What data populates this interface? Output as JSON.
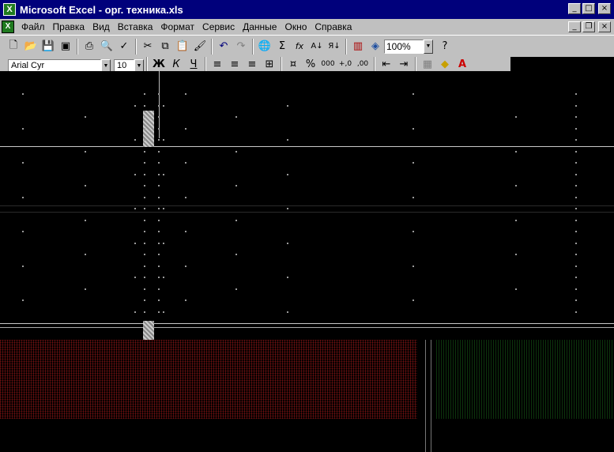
{
  "window": {
    "title": "Microsoft Excel - орг. техника.xls",
    "app_icon": "excel-icon",
    "buttons": {
      "minimize": "_",
      "maximize": "□",
      "close": "×"
    }
  },
  "menu": {
    "items": [
      "Файл",
      "Правка",
      "Вид",
      "Вставка",
      "Формат",
      "Сервис",
      "Данные",
      "Окно",
      "Справка"
    ],
    "doc_buttons": {
      "minimize": "_",
      "restore": "❐",
      "close": "×"
    }
  },
  "toolbar_standard": {
    "icons": [
      "new-icon",
      "open-icon",
      "save-icon",
      "permission-icon",
      "print-icon",
      "print-preview-icon",
      "spelling-icon",
      "cut-icon",
      "copy-icon",
      "paste-icon",
      "format-painter-icon",
      "undo-icon",
      "redo-icon",
      "hyperlink-icon",
      "autosum-icon",
      "function-icon",
      "sort-ascending-icon",
      "sort-descending-icon",
      "chart-wizard-icon",
      "drawing-icon",
      "help-icon"
    ],
    "autosum_glyph": "Σ",
    "function_glyph": "fx",
    "zoom": "100%"
  },
  "toolbar_formatting": {
    "font_name": "Arial Cyr",
    "font_size": "10",
    "bold": "Ж",
    "italic": "К",
    "underline": "Ч",
    "percent": "%",
    "thousands": "000",
    "inc_decimal": "+,0",
    "dec_decimal": ",00",
    "font_color_glyph": "A"
  }
}
